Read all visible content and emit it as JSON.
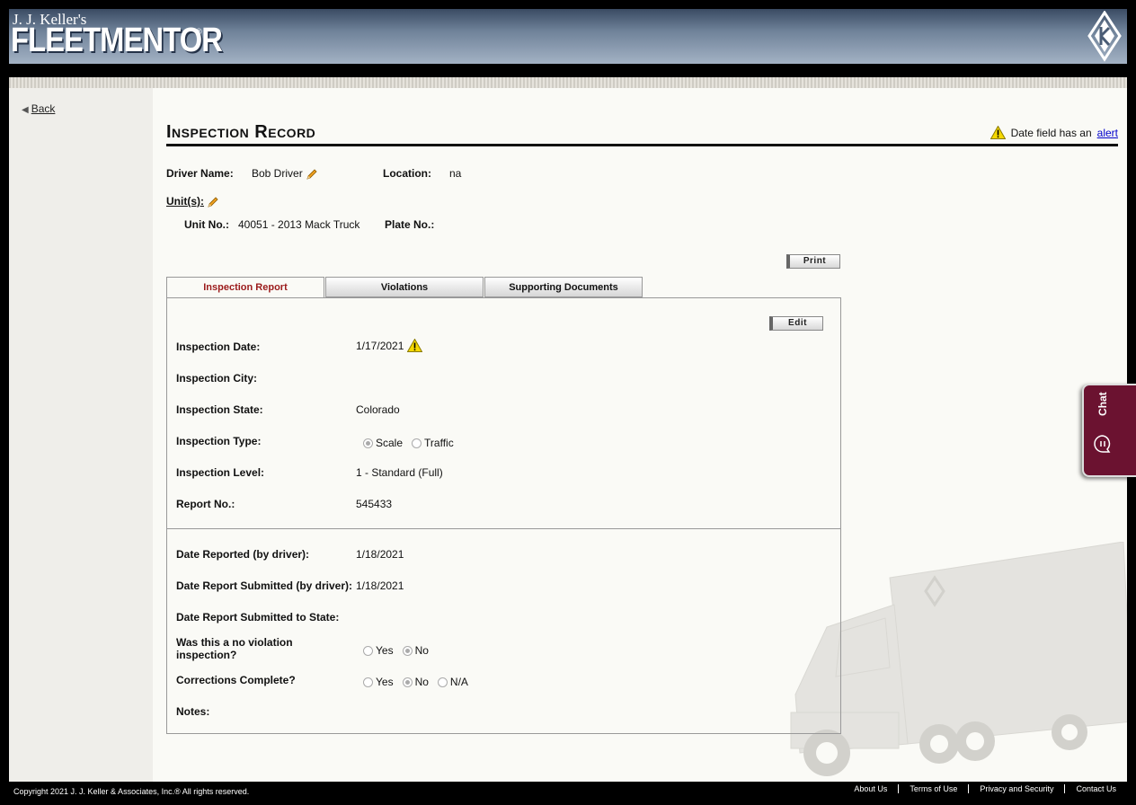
{
  "header": {
    "logo_top": "J. J. Keller's",
    "logo_main": "FLEETMENTOR",
    "logo_reg": "®"
  },
  "sidebar": {
    "back_label": "Back"
  },
  "page": {
    "title": "Inspection Record",
    "alert_text": "Date field has an",
    "alert_link": "alert"
  },
  "record": {
    "driver_label": "Driver Name:",
    "driver_value": "Bob Driver",
    "location_label": "Location:",
    "location_value": "na",
    "units_label": "Unit(s):",
    "unit_no_label": "Unit No.:",
    "unit_no_value": "40051 - 2013 Mack Truck",
    "plate_label": "Plate No.:",
    "plate_value": ""
  },
  "buttons": {
    "print": "Print",
    "edit": "Edit"
  },
  "tabs": [
    {
      "label": "Inspection Report",
      "active": true
    },
    {
      "label": "Violations",
      "active": false
    },
    {
      "label": "Supporting Documents",
      "active": false
    }
  ],
  "inspection": {
    "date_label": "Inspection Date:",
    "date_value": "1/17/2021",
    "city_label": "Inspection City:",
    "city_value": "",
    "state_label": "Inspection State:",
    "state_value": "Colorado",
    "type_label": "Inspection Type:",
    "type_options": [
      "Scale",
      "Traffic"
    ],
    "type_selected": "Scale",
    "level_label": "Inspection Level:",
    "level_value": "1 - Standard (Full)",
    "report_label": "Report No.:",
    "report_value": "545433"
  },
  "reporting": {
    "date_reported_label": "Date Reported (by driver):",
    "date_reported_value": "1/18/2021",
    "submitted_driver_label": "Date Report Submitted (by driver):",
    "submitted_driver_value": "1/18/2021",
    "submitted_state_label": "Date Report Submitted to State:",
    "submitted_state_value": "",
    "no_violation_label_1": "Was this a no violation",
    "no_violation_label_2": "inspection?",
    "no_violation_options": [
      "Yes",
      "No"
    ],
    "no_violation_selected": "No",
    "corrections_label": "Corrections Complete?",
    "corrections_options": [
      "Yes",
      "No",
      "N/A"
    ],
    "corrections_selected": "No",
    "notes_label": "Notes:"
  },
  "chat": {
    "label": "Chat"
  },
  "footer": {
    "copyright": "Copyright 2021 J. J. Keller & Associates, Inc.® All rights reserved.",
    "links": [
      "About Us",
      "Terms of Use",
      "Privacy and Security",
      "Contact Us"
    ]
  },
  "colors": {
    "header_top": "#3a4b63",
    "header_bottom": "#a3b2c4",
    "active_tab_text": "#9b1b1b",
    "chat_bg": "#6b1230",
    "alert_yellow": "#f5d800",
    "link_blue": "#0000cc"
  }
}
